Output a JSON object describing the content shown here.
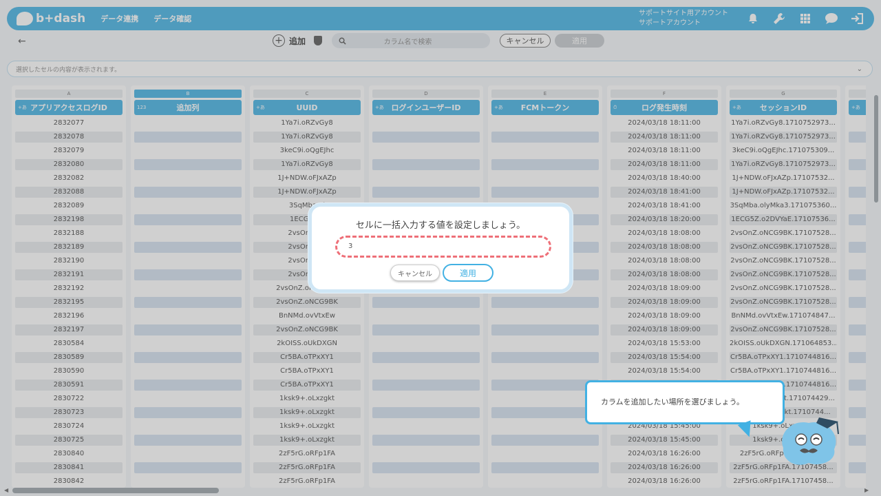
{
  "header": {
    "logo_text": "b+dash",
    "nav": [
      "データ連携",
      "データ確認"
    ],
    "account_line1": "サポートサイト用アカウント",
    "account_line2": "サポートアカウント",
    "icons": [
      "bell-icon",
      "wrench-icon",
      "grid-icon",
      "chat-icon",
      "logout-icon"
    ]
  },
  "toolbar": {
    "back_icon": "←",
    "add_label": "追加",
    "search_placeholder": "カラム名で検索",
    "cancel_label": "キャンセル",
    "apply_label": "適用"
  },
  "cellbar": {
    "text": "選択したセルの内容が表示されます。"
  },
  "columns": [
    {
      "letter": "A",
      "type": "+あ",
      "name": "アプリアクセスログID"
    },
    {
      "letter": "B",
      "type": "123",
      "name": "追加列"
    },
    {
      "letter": "C",
      "type": "+あ",
      "name": "UUID"
    },
    {
      "letter": "D",
      "type": "+あ",
      "name": "ログインユーザーID"
    },
    {
      "letter": "E",
      "type": "+あ",
      "name": "FCMトークン"
    },
    {
      "letter": "F",
      "type": "⏱",
      "name": "ログ発生時刻"
    },
    {
      "letter": "G",
      "type": "+あ",
      "name": "セッションID"
    },
    {
      "letter": "H",
      "type": "+あ",
      "name": ""
    }
  ],
  "col_a": [
    "2832077",
    "2832078",
    "2832079",
    "2832080",
    "2832082",
    "2832088",
    "2832089",
    "2832198",
    "2832188",
    "2832189",
    "2832190",
    "2832191",
    "2832192",
    "2832195",
    "2832196",
    "2832197",
    "2830584",
    "2830589",
    "2830590",
    "2830591",
    "2830722",
    "2830723",
    "2830724",
    "2830725",
    "2830840",
    "2830841",
    "2830842"
  ],
  "col_c": [
    "1Ya7i.oRZvGy8",
    "1Ya7i.oRZvGy8",
    "3keC9i.oQgEJhc",
    "1Ya7i.oRZvGy8",
    "1J+NDW.oFJxAZp",
    "1J+NDW.oFJxAZp",
    "3SqMba.ol",
    "1ECG5Z.o",
    "2vsOnZ.oN",
    "2vsOnZ.oN",
    "2vsOnZ.oN",
    "2vsOnZ.oN",
    "2vsOnZ.oNCG9BK",
    "2vsOnZ.oNCG9BK",
    "BnNMd.ovVtxEw",
    "2vsOnZ.oNCG9BK",
    "2kOISS.oUkDXGN",
    "Cr5BA.oTPxXY1",
    "Cr5BA.oTPxXY1",
    "Cr5BA.oTPxXY1",
    "1ksk9+.oLxzgkt",
    "1ksk9+.oLxzgkt",
    "1ksk9+.oLxzgkt",
    "1ksk9+.oLxzgkt",
    "2zF5rG.oRFp1FA",
    "2zF5rG.oRFp1FA",
    "2zF5rG.oRFp1FA"
  ],
  "col_f": [
    "2024/03/18 18:11:00",
    "2024/03/18 18:11:00",
    "2024/03/18 18:11:00",
    "2024/03/18 18:11:00",
    "2024/03/18 18:40:00",
    "2024/03/18 18:41:00",
    "2024/03/18 18:41:00",
    "2024/03/18 18:20:00",
    "2024/03/18 18:08:00",
    "2024/03/18 18:08:00",
    "2024/03/18 18:08:00",
    "2024/03/18 18:08:00",
    "2024/03/18 18:09:00",
    "2024/03/18 18:09:00",
    "2024/03/18 18:09:00",
    "2024/03/18 18:09:00",
    "2024/03/18 15:53:00",
    "2024/03/18 15:54:00",
    "2024/03/18 15:54:00",
    "",
    "",
    "",
    "2024/03/18 15:45:00",
    "2024/03/18 15:45:00",
    "2024/03/18 16:26:00",
    "2024/03/18 16:26:00",
    "2024/03/18 16:26:00"
  ],
  "col_g": [
    "1Ya7i.oRZvGy8.1710752973...",
    "1Ya7i.oRZvGy8.1710752973...",
    "3keC9i.oQgEJhc.171075309...",
    "1Ya7i.oRZvGy8.1710752973...",
    "1J+NDW.oFJxAZp.17107532...",
    "1J+NDW.oFJxAZp.17107532...",
    "3SqMba.olyMka3.171075360...",
    "1ECG5Z.o2DVYaE.17107536...",
    "2vsOnZ.oNCG9BK.17107528...",
    "2vsOnZ.oNCG9BK.17107528...",
    "2vsOnZ.oNCG9BK.17107528...",
    "2vsOnZ.oNCG9BK.17107528...",
    "2vsOnZ.oNCG9BK.17107528...",
    "2vsOnZ.oNCG9BK.17107528...",
    "BnNMd.ovVtxEw.171074847...",
    "2vsOnZ.oNCG9BK.17107528...",
    "2kOISS.oUkDXGN.171064853...",
    "Cr5BA.oTPxXY1.1710744816...",
    "Cr5BA.oTPxXY1.1710744816...",
    "Cr5BA.oTPxXY1.1710744816...",
    "1ksk9+.oLxzgkt.171074429...",
    "1ksk9+.oLxzgkt.1710744...",
    "1ksk9+.oLxzgkt...",
    "1ksk9+.oLxzgkt...",
    "2zF5rG.oRFp1FA.17107...",
    "2zF5rG.oRFp1FA.17107458...",
    "2zF5rG.oRFp1FA.17107458..."
  ],
  "modal": {
    "title": "セルに一括入力する値を設定しましょう。",
    "input_value": "3",
    "cancel_label": "キャンセル",
    "apply_label": "適用"
  },
  "tooltip": {
    "text": "カラムを追加したい場所を選びましょう。"
  },
  "colors": {
    "accent": "#42b1e3",
    "dashed_border": "#ee6f78"
  }
}
